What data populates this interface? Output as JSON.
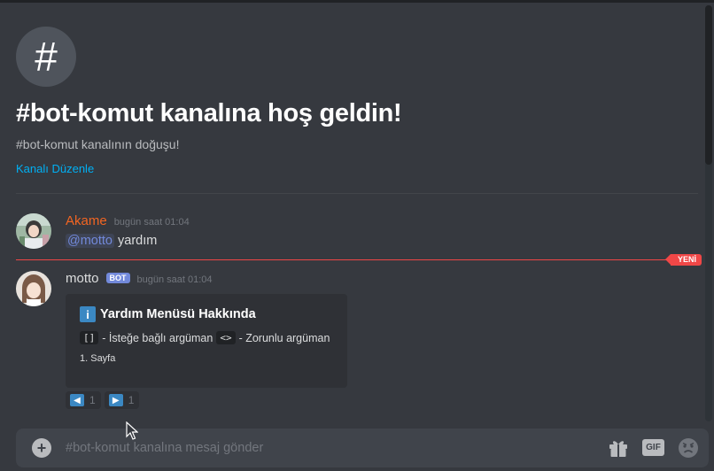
{
  "channel": {
    "hash_glyph": "#",
    "welcome_title": "#bot-komut kanalına hoş geldin!",
    "welcome_subtitle": "#bot-komut kanalının doğuşu!",
    "edit_link": "Kanalı Düzenle"
  },
  "messages": [
    {
      "username": "Akame",
      "username_color": "#f26522",
      "timestamp": "bugün saat 01:04",
      "mention": "@motto",
      "text": " yardım"
    },
    {
      "username": "motto",
      "username_color": "#dcddde",
      "bot_tag": "BOT",
      "timestamp": "bugün saat 01:04",
      "embed": {
        "icon": "information-icon",
        "icon_glyph": "i",
        "title": "Yardım Menüsü Hakkında",
        "code_optional": "[]",
        "text_optional": "- İsteğe bağlı argüman",
        "code_required": "<>",
        "text_required": "- Zorunlu argüman",
        "footer": "1. Sayfa"
      },
      "reactions": [
        {
          "icon": "arrow-left-icon",
          "glyph": "◀",
          "count": "1"
        },
        {
          "icon": "arrow-right-icon",
          "glyph": "▶",
          "count": "1"
        }
      ]
    }
  ],
  "new_badge": "YENİ",
  "composer": {
    "placeholder": "#bot-komut kanalına mesaj gönder",
    "gif_label": "GIF"
  },
  "colors": {
    "background": "#36393f",
    "link": "#00b0f4",
    "new_divider": "#f04747",
    "bot_tag": "#7289da"
  }
}
